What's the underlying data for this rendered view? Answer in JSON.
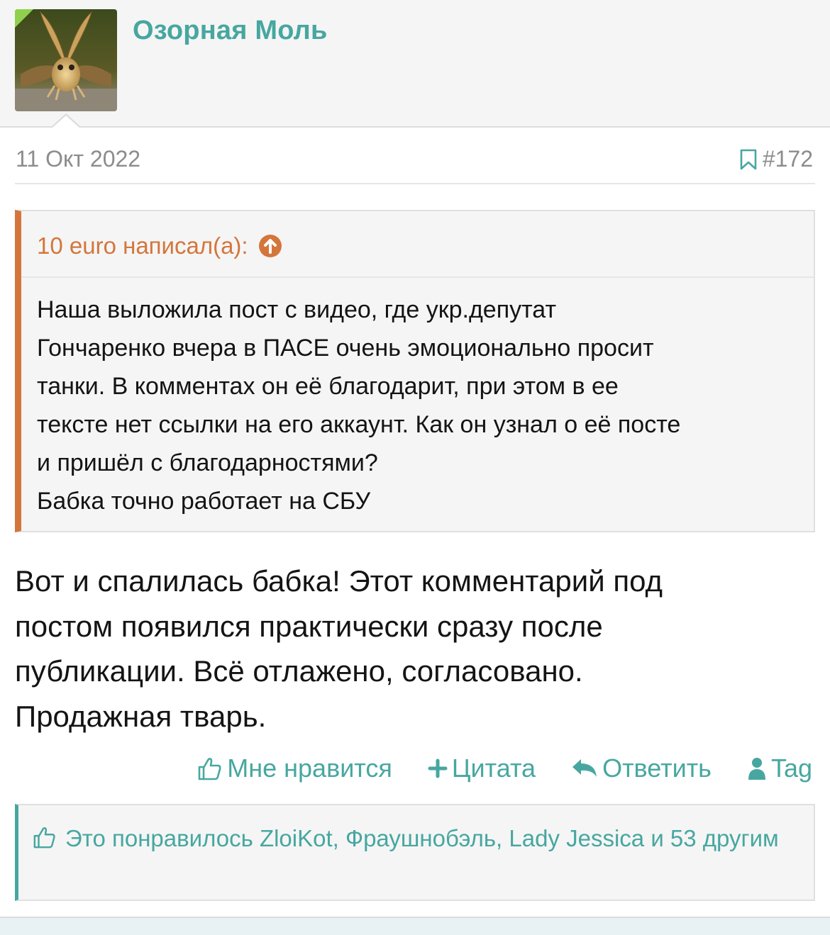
{
  "user": {
    "name": "Озорная Моль",
    "avatar": "moth-avatar"
  },
  "post": {
    "date": "11 Окт 2022",
    "number": "#172",
    "bookmark_icon": "bookmark-icon"
  },
  "quote": {
    "author": "10 euro написал(а):",
    "goto_icon": "arrow-up-circle-icon",
    "text": "Наша выложила пост с видео, где укр.депутат\nГончаренко вчера в ПАСЕ очень эмоционально просит\nтанки. В комментах он её благодарит, при этом в ее\nтексте нет ссылки на его аккаунт. Как он узнал о её посте\nи пришёл с благодарностями?\nБабка точно работает на СБУ"
  },
  "message": {
    "text": "Вот и спалилась бабка! Этот комментарий под\nпостом появился практически сразу после\nпубликации. Всё отлажено, согласовано.\nПродажная тварь."
  },
  "actions": {
    "like": "Мне нравится",
    "quote": "Цитата",
    "reply": "Ответить",
    "tag": "Tag"
  },
  "likes": {
    "text": "Это понравилось ZloiKot, Фраушнобэль, Lady Jessica и 53 другим"
  },
  "colors": {
    "accent": "#47a7a0",
    "quote_accent": "#d4763b",
    "muted": "#8c8c8c"
  }
}
